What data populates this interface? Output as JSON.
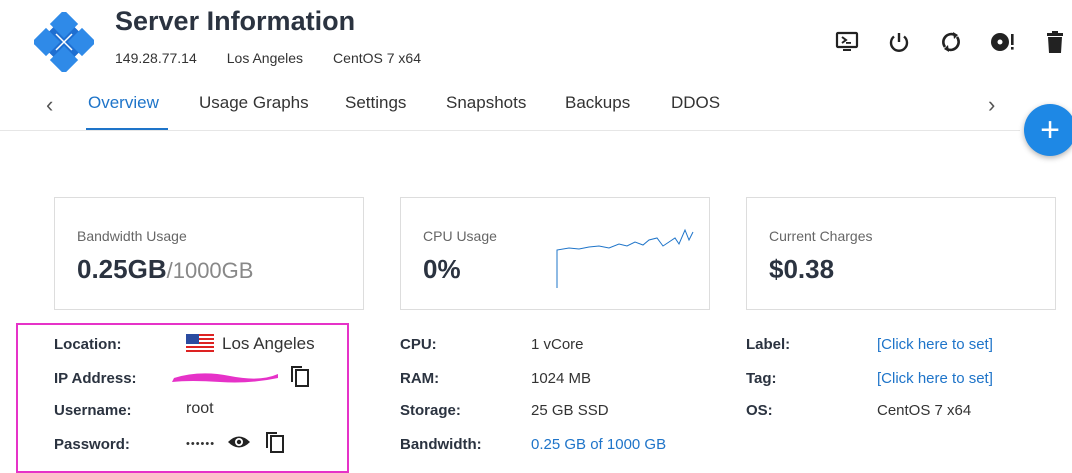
{
  "header": {
    "title": "Server Information",
    "ip": "149.28.77.14",
    "location": "Los Angeles",
    "os": "CentOS 7 x64"
  },
  "toolbar": {
    "icons": [
      "console-icon",
      "power-icon",
      "restart-icon",
      "reinstall-icon",
      "delete-icon"
    ]
  },
  "tabs": [
    "Overview",
    "Usage Graphs",
    "Settings",
    "Snapshots",
    "Backups",
    "DDOS"
  ],
  "active_tab": "Overview",
  "fab_label": "+",
  "cards": {
    "bandwidth": {
      "label": "Bandwidth Usage",
      "value": "0.25GB",
      "suffix": "/1000GB"
    },
    "cpu": {
      "label": "CPU Usage",
      "value": "0%"
    },
    "charges": {
      "label": "Current Charges",
      "value": "$0.38"
    }
  },
  "access": {
    "location_label": "Location:",
    "location_value": "Los Angeles",
    "ip_label": "IP Address:",
    "username_label": "Username:",
    "username_value": "root",
    "password_label": "Password:",
    "password_value": "••••••"
  },
  "specs": {
    "cpu_label": "CPU:",
    "cpu_value": "1 vCore",
    "ram_label": "RAM:",
    "ram_value": "1024 MB",
    "storage_label": "Storage:",
    "storage_value": "25 GB SSD",
    "bandwidth_label": "Bandwidth:",
    "bandwidth_value": "0.25 GB of 1000 GB"
  },
  "extra": {
    "label_label": "Label:",
    "label_value": "[Click here to set]",
    "tag_label": "Tag:",
    "tag_value": "[Click here to set]",
    "os_label": "OS:",
    "os_value": "CentOS 7 x64"
  },
  "colors": {
    "accent": "#1e74c9",
    "highlight": "#e632c8",
    "fab": "#1e88e5"
  }
}
